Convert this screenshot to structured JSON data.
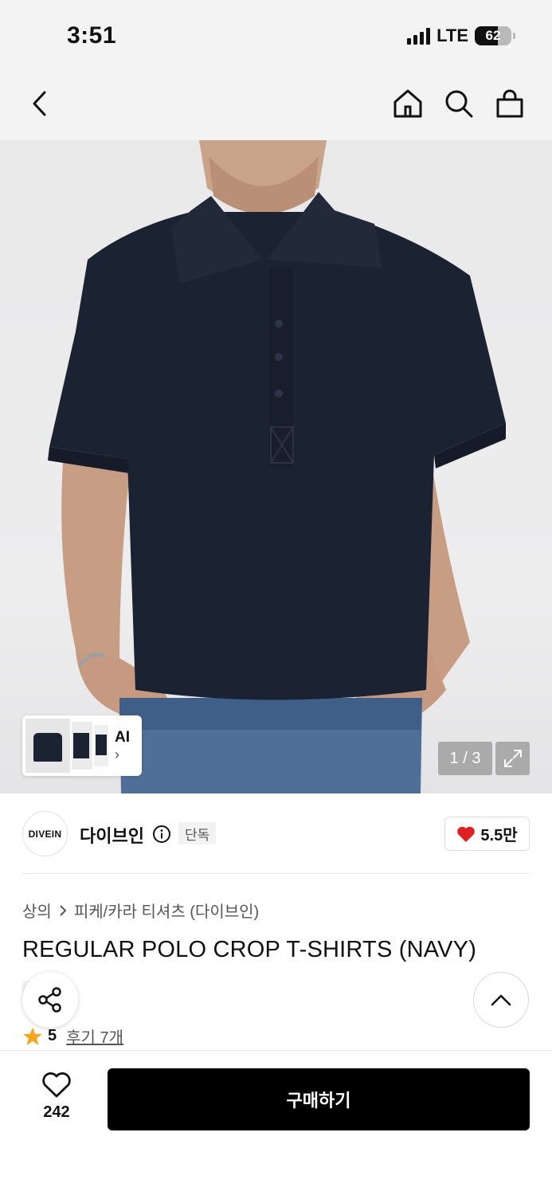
{
  "status": {
    "time": "3:51",
    "network": "LTE",
    "battery": "62",
    "battery_level": 0.62
  },
  "nav": {
    "icons": [
      "back-arrow-icon",
      "home-icon",
      "search-icon",
      "shopping-bag-icon"
    ]
  },
  "gallery": {
    "counter": "1 / 3",
    "ai_label": "AI",
    "expand_icon": "expand-icon"
  },
  "brand": {
    "logo_text": "DIVEIN",
    "name": "다이브인",
    "badge": "단독",
    "like_count": "5.5만",
    "like_color": "#e02020"
  },
  "breadcrumb": {
    "level1": "상의",
    "level2": "피케/카라 티셔츠 (다이브인)"
  },
  "product": {
    "title": "REGULAR POLO CROP T-SHIRTS (NAVY)",
    "tag": "단독"
  },
  "rating": {
    "score": "5",
    "reviews": "후기 7개",
    "star_color": "#f5a623"
  },
  "bottom": {
    "wish_count": "242",
    "buy_label": "구매하기"
  }
}
